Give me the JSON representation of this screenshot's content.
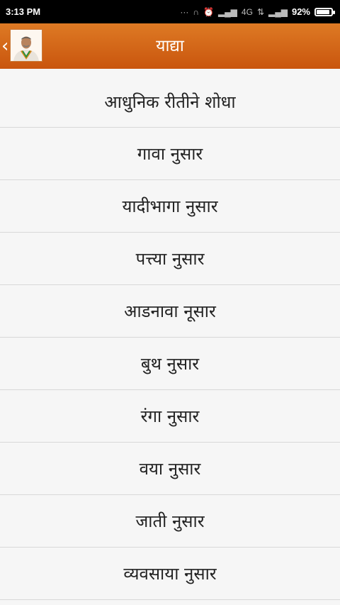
{
  "status": {
    "time": "3:13 PM",
    "network": "4G",
    "battery": "92%",
    "battery_level": 0.92
  },
  "header": {
    "title": "याद्या"
  },
  "menu": {
    "items": [
      {
        "label": "आधुनिक रीतीने शोधा"
      },
      {
        "label": "गावा नुसार"
      },
      {
        "label": "यादीभागा नुसार"
      },
      {
        "label": "पत्त्या नुसार"
      },
      {
        "label": "आडनावा नूसार"
      },
      {
        "label": "बुथ नुसार"
      },
      {
        "label": "रंगा नुसार"
      },
      {
        "label": "वया नुसार"
      },
      {
        "label": "जाती नुसार"
      },
      {
        "label": "व्यवसाया नुसार"
      }
    ]
  },
  "colors": {
    "header_top": "#de7a24",
    "header_bottom": "#c9550e",
    "list_bg": "#f6f6f6",
    "divider": "#d8d8d8"
  }
}
